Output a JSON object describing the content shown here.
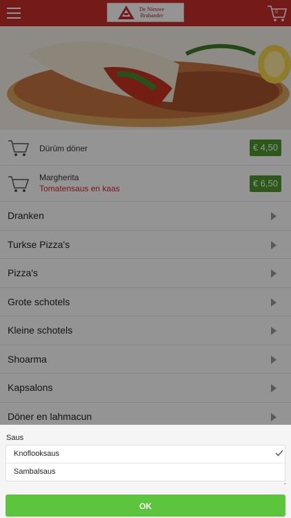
{
  "header": {
    "logo_line1": "De Nieuwe",
    "logo_line2": "Brabander",
    "cart_count": "0",
    "brand_color": "#c9302c"
  },
  "cart_items": [
    {
      "name": "Dürüm döner",
      "subtitle": "",
      "price": "€ 4,50"
    },
    {
      "name": "Margherita",
      "subtitle": "Tomatensaus en kaas",
      "price": "€ 6,50"
    }
  ],
  "categories": [
    "Dranken",
    "Turkse Pizza's",
    "Pizza's",
    "Grote schotels",
    "Kleine schotels",
    "Shoarma",
    "Kapsalons",
    "Döner en lahmacun"
  ],
  "sheet": {
    "title": "Saus",
    "options": [
      {
        "label": "Knoflooksaus",
        "selected": true
      },
      {
        "label": "Sambalsaus",
        "selected": false
      }
    ],
    "ok_label": "OK"
  },
  "colors": {
    "price_badge": "#4c9a2e",
    "ok_button": "#5dc43e",
    "subtitle_red": "#d0262d"
  }
}
